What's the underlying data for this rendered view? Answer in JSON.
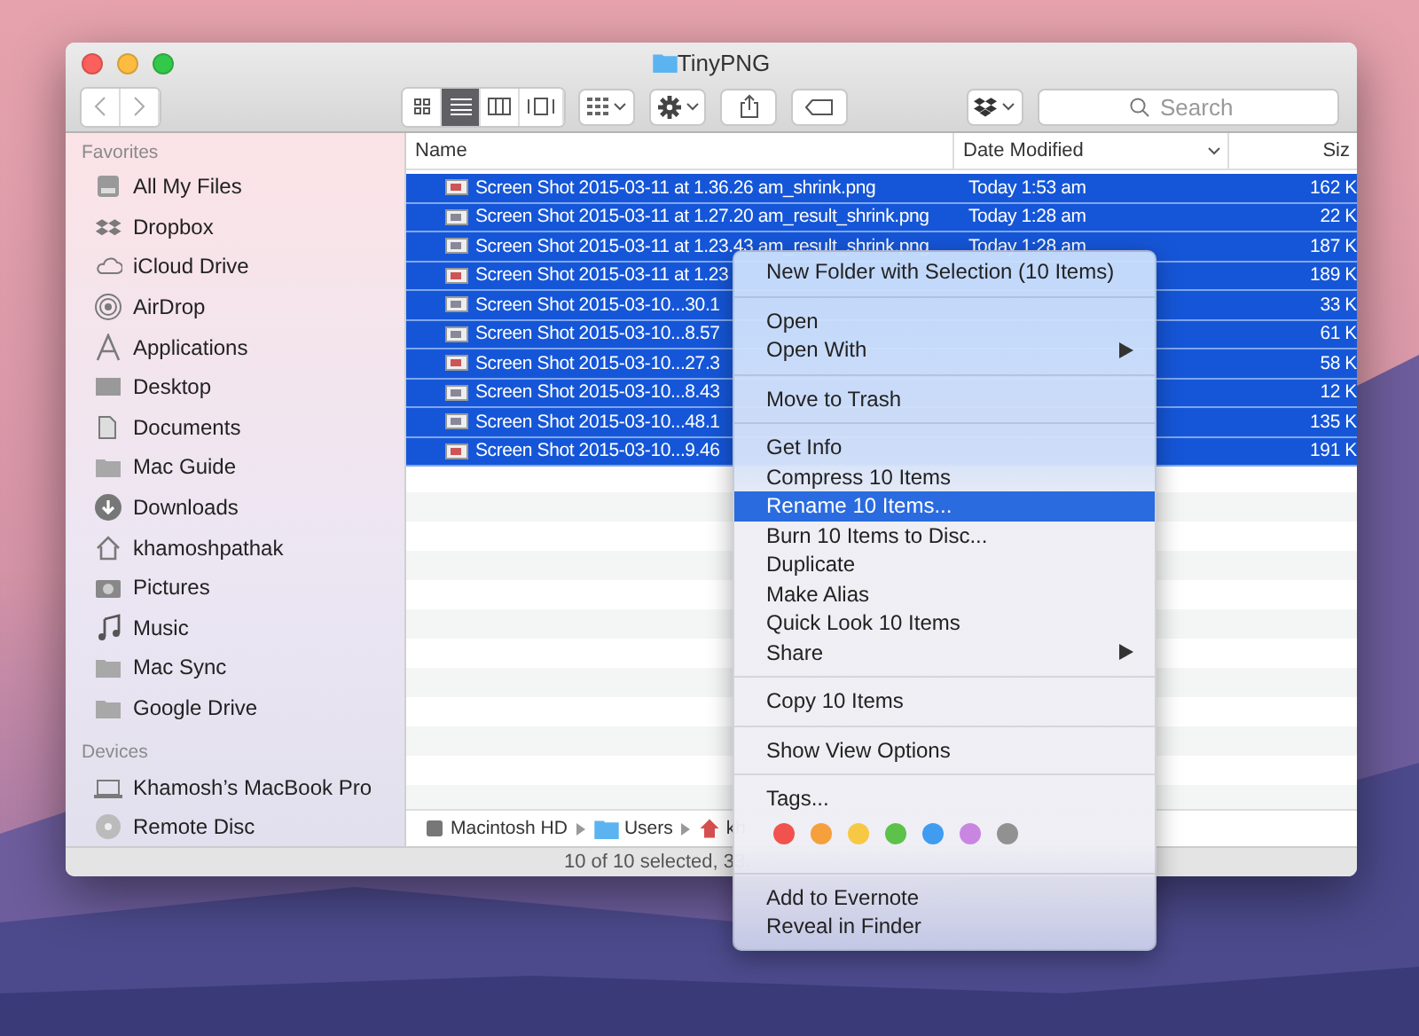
{
  "window": {
    "title": "TinyPNG"
  },
  "toolbar": {
    "view_modes": [
      {
        "kind": "icons",
        "selected": false
      },
      {
        "kind": "list",
        "selected": true
      },
      {
        "kind": "columns",
        "selected": false
      },
      {
        "kind": "coverflow",
        "selected": false
      }
    ],
    "search": {
      "placeholder": "Search"
    }
  },
  "sidebar": {
    "sections": [
      {
        "heading": "Favorites",
        "items": [
          {
            "label": "All My Files",
            "kind": "files"
          },
          {
            "label": "Dropbox",
            "kind": "dropbox"
          },
          {
            "label": "iCloud Drive",
            "kind": "cloud"
          },
          {
            "label": "AirDrop",
            "kind": "airdrop"
          },
          {
            "label": "Applications",
            "kind": "apps"
          },
          {
            "label": "Desktop",
            "kind": "desktop"
          },
          {
            "label": "Documents",
            "kind": "documents"
          },
          {
            "label": "Mac Guide",
            "kind": "folder"
          },
          {
            "label": "Downloads",
            "kind": "downloads"
          },
          {
            "label": "khamoshpathak",
            "kind": "home"
          },
          {
            "label": "Pictures",
            "kind": "camera"
          },
          {
            "label": "Music",
            "kind": "music"
          },
          {
            "label": "Mac Sync",
            "kind": "folder"
          },
          {
            "label": "Google Drive",
            "kind": "folder"
          }
        ]
      },
      {
        "heading": "Devices",
        "items": [
          {
            "label": "Khamosh’s MacBook Pro",
            "kind": "laptop"
          },
          {
            "label": "Remote Disc",
            "kind": "disc"
          }
        ]
      }
    ]
  },
  "table": {
    "columns": [
      "Name",
      "Date Modified",
      "Siz"
    ],
    "rows": [
      {
        "name": "Screen Shot 2015-03-11 at 1.36.26 am_shrink.png",
        "date": "Today 1:53 am",
        "size": "162 K",
        "selected": true
      },
      {
        "name": "Screen Shot 2015-03-11 at 1.27.20 am_result_shrink.png",
        "date": "Today 1:28 am",
        "size": "22 K",
        "selected": true
      },
      {
        "name": "Screen Shot 2015-03-11 at 1.23.43 am_result_shrink.png",
        "date": "Today 1:28 am",
        "size": "187 K",
        "selected": true
      },
      {
        "name": "Screen Shot 2015-03-11 at 1.23",
        "size": "189 K",
        "selected": true
      },
      {
        "name": "Screen Shot 2015-03-10...30.1",
        "size": "33 K",
        "selected": true
      },
      {
        "name": "Screen Shot 2015-03-10...8.57",
        "size": "61 K",
        "selected": true
      },
      {
        "name": "Screen Shot 2015-03-10...27.3",
        "size": "58 K",
        "selected": true
      },
      {
        "name": "Screen Shot 2015-03-10...8.43",
        "size": "12 K",
        "selected": true
      },
      {
        "name": "Screen Shot 2015-03-10...48.1",
        "size": "135 K",
        "selected": true
      },
      {
        "name": "Screen Shot 2015-03-10...9.46",
        "size": "191 K",
        "selected": true
      }
    ]
  },
  "path_bar": [
    {
      "label": "Macintosh HD",
      "kind": "disk"
    },
    {
      "label": "Users",
      "kind": "folder"
    },
    {
      "label": "kh",
      "kind": "home"
    }
  ],
  "status_bar": "10 of 10 selected, 33.",
  "context_menu": {
    "sections": [
      [
        {
          "label": "New Folder with Selection (10 Items)",
          "selected": false,
          "submenu": false
        }
      ],
      [
        {
          "label": "Open",
          "selected": false,
          "submenu": false
        },
        {
          "label": "Open With",
          "selected": false,
          "submenu": true
        }
      ],
      [
        {
          "label": "Move to Trash",
          "selected": false,
          "submenu": false
        }
      ],
      [
        {
          "label": "Get Info",
          "selected": false,
          "submenu": false
        },
        {
          "label": "Compress 10 Items",
          "selected": false,
          "submenu": false
        },
        {
          "label": "Rename 10 Items...",
          "selected": true,
          "submenu": false
        },
        {
          "label": "Burn 10 Items to Disc...",
          "selected": false,
          "submenu": false
        },
        {
          "label": "Duplicate",
          "selected": false,
          "submenu": false
        },
        {
          "label": "Make Alias",
          "selected": false,
          "submenu": false
        },
        {
          "label": "Quick Look 10 Items",
          "selected": false,
          "submenu": false
        },
        {
          "label": "Share",
          "selected": false,
          "submenu": true
        }
      ],
      [
        {
          "label": "Copy 10 Items",
          "selected": false,
          "submenu": false
        }
      ],
      [
        {
          "label": "Show View Options",
          "selected": false,
          "submenu": false
        }
      ]
    ],
    "tags": {
      "label": "Tags...",
      "colors": [
        {
          "color": "#f2524e"
        },
        {
          "color": "#f5a03c"
        },
        {
          "color": "#f7c844"
        },
        {
          "color": "#5cc24a"
        },
        {
          "color": "#3f9cf0"
        },
        {
          "color": "#c986e0"
        },
        {
          "color": "#919191"
        }
      ]
    },
    "services": [
      {
        "label": "Add to Evernote",
        "selected": false,
        "submenu": false
      },
      {
        "label": "Reveal in Finder",
        "selected": false,
        "submenu": false
      }
    ]
  }
}
